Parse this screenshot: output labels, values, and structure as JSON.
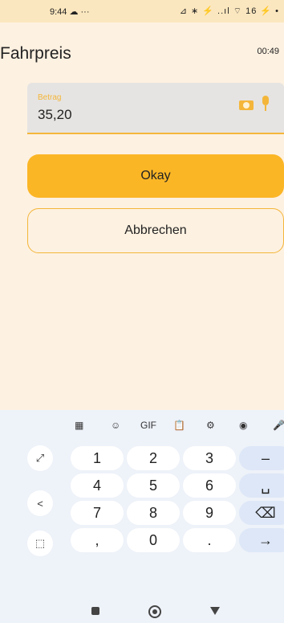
{
  "statusbar": {
    "time": "9:44 ☁ ···",
    "icons": "⊿ ∗ ⚡ ..ıl ⌔ 16 ⚡ •"
  },
  "header": {
    "title": "Fahrpreis",
    "timer": "00:49"
  },
  "amount_field": {
    "label": "Betrag",
    "value": "35,20"
  },
  "buttons": {
    "okay": "Okay",
    "cancel": "Abbrechen"
  },
  "keyboard": {
    "toolbar": [
      {
        "name": "apps-icon",
        "glyph": "▦"
      },
      {
        "name": "sticker-icon",
        "glyph": "☺"
      },
      {
        "name": "gif-icon",
        "glyph": "GIF"
      },
      {
        "name": "clipboard-icon",
        "glyph": "📋"
      },
      {
        "name": "settings-icon",
        "glyph": "⚙"
      },
      {
        "name": "palette-icon",
        "glyph": "◉"
      },
      {
        "name": "mic-icon",
        "glyph": "🎤"
      }
    ],
    "side_keys": [
      {
        "name": "expand-icon",
        "glyph": "⤢"
      },
      {
        "name": "back-arrow-icon",
        "glyph": "<"
      },
      {
        "name": "select-icon",
        "glyph": "⬚"
      }
    ],
    "rows": [
      [
        "1",
        "2",
        "3",
        "–"
      ],
      [
        "4",
        "5",
        "6",
        "␣"
      ],
      [
        "7",
        "8",
        "9",
        "⌫"
      ],
      [
        ",",
        "0",
        ".",
        "→"
      ]
    ]
  },
  "navbar": {
    "home": "home",
    "back": "back",
    "recents": "recents"
  }
}
